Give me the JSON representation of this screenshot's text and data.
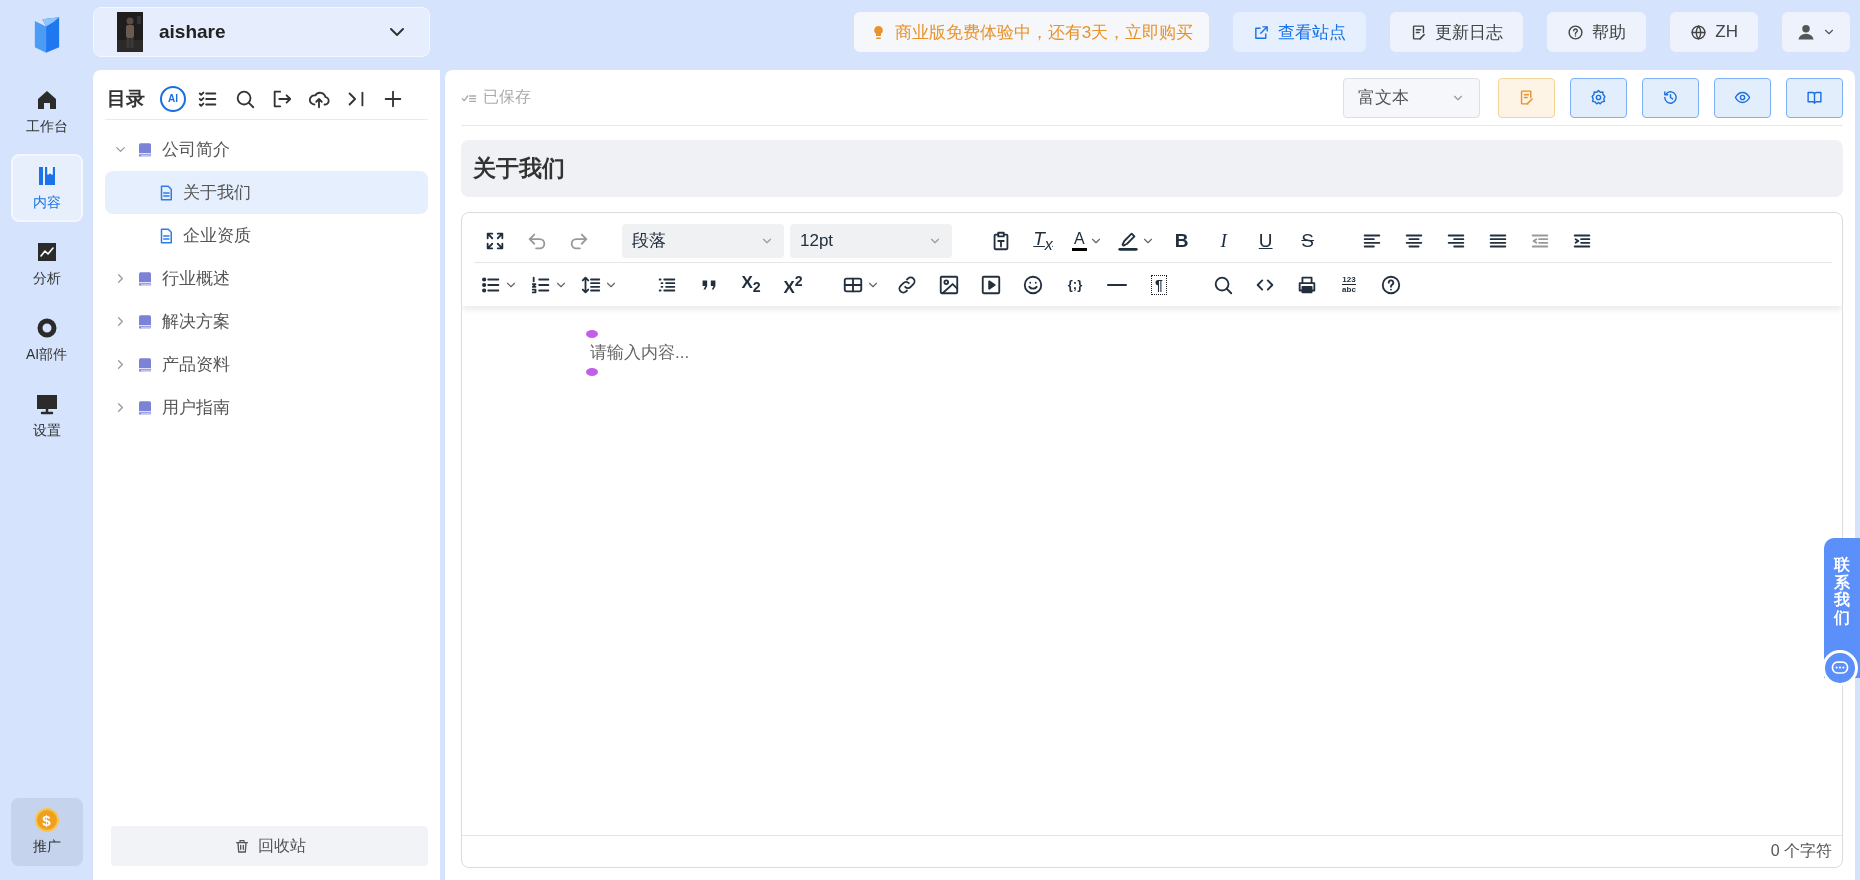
{
  "topbar": {
    "workspace": {
      "name": "aishare"
    },
    "buttons": [
      {
        "kind": "promo",
        "label": "商业版免费体验中，还有3天，立即购买"
      },
      {
        "kind": "accent",
        "label": "查看站点"
      },
      {
        "kind": "plain",
        "label": "更新日志"
      },
      {
        "kind": "plain",
        "label": "帮助"
      },
      {
        "kind": "plain",
        "label": "ZH"
      },
      {
        "kind": "menu"
      }
    ]
  },
  "nav": {
    "items": [
      {
        "label": "工作台",
        "selected": false
      },
      {
        "label": "内容",
        "selected": true
      },
      {
        "label": "分析",
        "selected": false
      },
      {
        "label": "AI部件",
        "selected": false
      },
      {
        "label": "设置",
        "selected": false
      }
    ],
    "promo": {
      "label": "推广",
      "symbol": "$"
    }
  },
  "catalog": {
    "title": "目录",
    "ai_badge": "AI",
    "items": [
      {
        "label": "公司简介",
        "selected": false,
        "expanded": true,
        "children": [
          {
            "label": "关于我们",
            "selected": true
          },
          {
            "label": "企业资质",
            "selected": false
          }
        ]
      },
      {
        "label": "行业概述",
        "selected": false,
        "expanded": false
      },
      {
        "label": "解决方案",
        "selected": false,
        "expanded": false
      },
      {
        "label": "产品资料",
        "selected": false,
        "expanded": false
      },
      {
        "label": "用户指南",
        "selected": false,
        "expanded": false
      }
    ],
    "recycle_bin": "回收站"
  },
  "editor": {
    "save_status": "已保存",
    "mode": {
      "value": "富文本"
    },
    "actions": [
      {
        "kind": "warn"
      },
      {
        "kind": "primary"
      },
      {
        "kind": "primary"
      },
      {
        "kind": "primary"
      },
      {
        "kind": "primary"
      }
    ],
    "title": "关于我们",
    "toolbar": [
      {
        "kind": "select",
        "value": "段落"
      },
      {
        "kind": "select",
        "value": "12pt"
      },
      {
        "kind": "glyph",
        "text": "T$_{x}$"
      },
      {
        "kind": "glyph",
        "text": "A"
      },
      {
        "kind": "glyph",
        "text": "B"
      },
      {
        "kind": "glyph",
        "text": "I"
      },
      {
        "kind": "glyph",
        "text": "U"
      },
      {
        "kind": "glyph",
        "text": "S"
      },
      {
        "kind": "glyph",
        "text": "X$_{2}$"
      },
      {
        "kind": "glyph",
        "text": "X$^{2}$"
      },
      {
        "kind": "glyph",
        "text": "{;}"
      },
      {
        "kind": "glyph",
        "text": "¶"
      },
      {
        "kind": "stack",
        "text": "123",
        "sub": "abc"
      }
    ],
    "placeholder": "请输入内容...",
    "char_count": "0 个字符"
  },
  "contact": {
    "label": "联系我们"
  }
}
